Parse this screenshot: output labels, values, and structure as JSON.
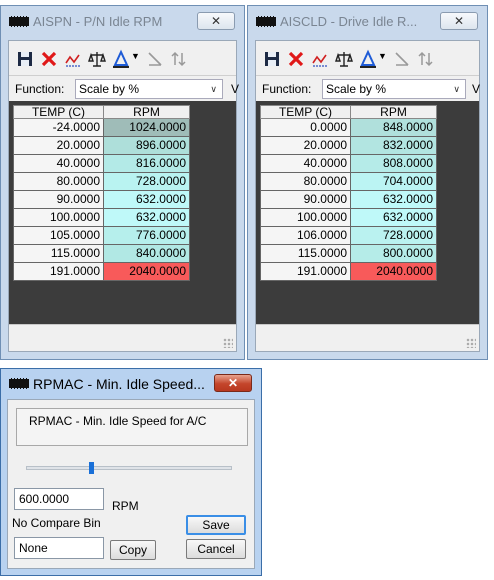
{
  "colors": {
    "red_cell": "#f85a5a",
    "cyan": "#7ef7f7",
    "teal_light": "#a8e6e2"
  },
  "windows": [
    {
      "title": "AISPN - P/N Idle RPM",
      "close_label": "✕",
      "function_label": "Function:",
      "function_value": "Scale by %",
      "v_label": "V",
      "headers": [
        "TEMP (C)",
        "RPM"
      ],
      "rows": [
        {
          "temp": "-24.0000",
          "rpm": "1024.0000",
          "color": "#a2c0bc"
        },
        {
          "temp": "20.0000",
          "rpm": "896.0000",
          "color": "#aedfda"
        },
        {
          "temp": "40.0000",
          "rpm": "816.0000",
          "color": "#b3eae7"
        },
        {
          "temp": "80.0000",
          "rpm": "728.0000",
          "color": "#b9f3f1"
        },
        {
          "temp": "90.0000",
          "rpm": "632.0000",
          "color": "#bff9f9"
        },
        {
          "temp": "100.0000",
          "rpm": "632.0000",
          "color": "#bff9f9"
        },
        {
          "temp": "105.0000",
          "rpm": "776.0000",
          "color": "#b6efec"
        },
        {
          "temp": "115.0000",
          "rpm": "840.0000",
          "color": "#b1e8e4"
        },
        {
          "temp": "191.0000",
          "rpm": "2040.0000",
          "color": "#f85a5a"
        }
      ]
    },
    {
      "title": "AISCLD - Drive Idle R...",
      "close_label": "✕",
      "function_label": "Function:",
      "function_value": "Scale by %",
      "v_label": "V",
      "headers": [
        "TEMP (C)",
        "RPM"
      ],
      "rows": [
        {
          "temp": "0.0000",
          "rpm": "848.0000",
          "color": "#b0e0dc"
        },
        {
          "temp": "20.0000",
          "rpm": "832.0000",
          "color": "#b2e5e1"
        },
        {
          "temp": "40.0000",
          "rpm": "808.0000",
          "color": "#b5ebe8"
        },
        {
          "temp": "80.0000",
          "rpm": "704.0000",
          "color": "#bbf4f3"
        },
        {
          "temp": "90.0000",
          "rpm": "632.0000",
          "color": "#bff9f9"
        },
        {
          "temp": "100.0000",
          "rpm": "632.0000",
          "color": "#bff9f9"
        },
        {
          "temp": "106.0000",
          "rpm": "728.0000",
          "color": "#baf2f0"
        },
        {
          "temp": "115.0000",
          "rpm": "800.0000",
          "color": "#b5ece8"
        },
        {
          "temp": "191.0000",
          "rpm": "2040.0000",
          "color": "#f85a5a"
        }
      ]
    }
  ],
  "dialog": {
    "title": "RPMAC - Min. Idle Speed...",
    "close_label": "✕",
    "description": "RPMAC - Min. Idle Speed for A/C",
    "value": "600.0000",
    "unit": "RPM",
    "compare_label": "No Compare Bin",
    "compare_value": "None",
    "save_label": "Save",
    "copy_label": "Copy",
    "cancel_label": "Cancel"
  }
}
